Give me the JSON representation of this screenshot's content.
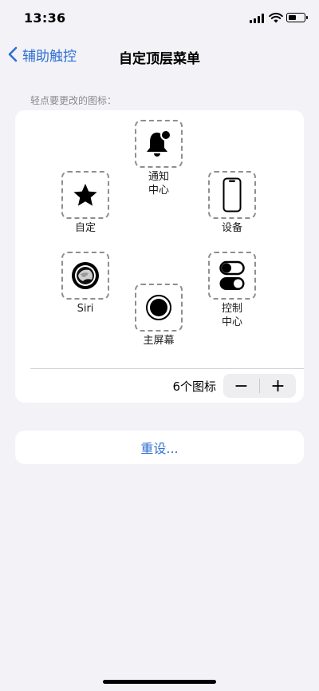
{
  "status_bar": {
    "time": "13:36"
  },
  "nav": {
    "back_label": "辅助触控",
    "title": "自定顶层菜单"
  },
  "caption": "轻点要更改的图标：",
  "tiles": [
    {
      "label": "通知\n中心",
      "icon": "bell-icon"
    },
    {
      "label": "自定",
      "icon": "star-icon"
    },
    {
      "label": "设备",
      "icon": "iphone-icon"
    },
    {
      "label": "Siri",
      "icon": "siri-icon"
    },
    {
      "label": "控制\n中心",
      "icon": "toggles-icon"
    },
    {
      "label": "主屏幕",
      "icon": "home-button-icon"
    }
  ],
  "counter": {
    "label": "6个图标",
    "minus": "−",
    "plus": "+"
  },
  "reset": {
    "label": "重设..."
  }
}
